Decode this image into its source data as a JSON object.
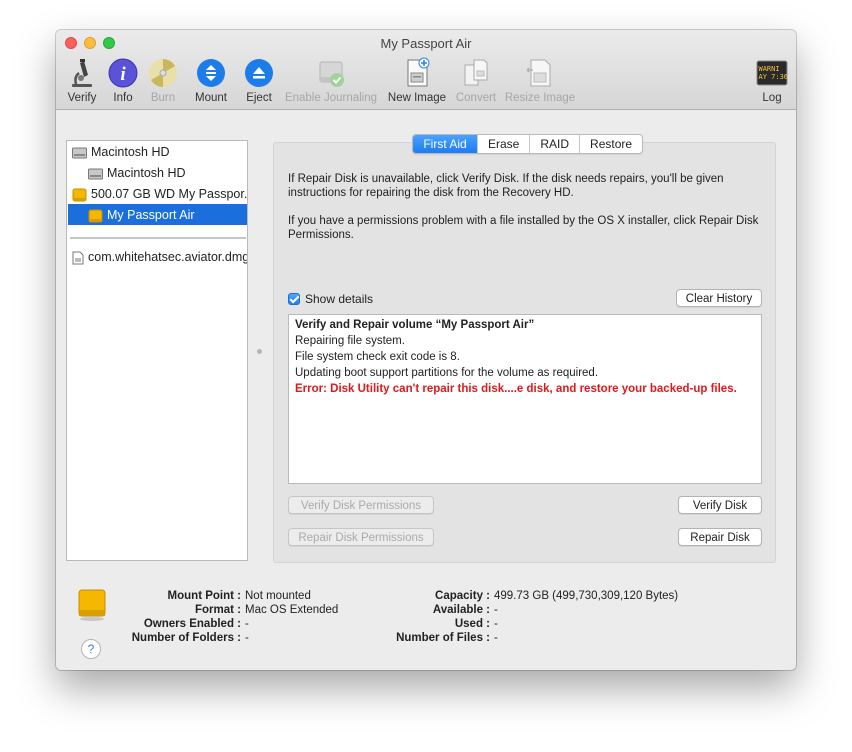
{
  "window": {
    "title": "My Passport Air"
  },
  "toolbar": {
    "verify": "Verify",
    "info": "Info",
    "burn": "Burn",
    "mount": "Mount",
    "eject": "Eject",
    "enable_journaling": "Enable Journaling",
    "new_image": "New Image",
    "convert": "Convert",
    "resize_image": "Resize Image",
    "log": "Log",
    "log_icon_text_1": "WARNI",
    "log_icon_text_2": "AY 7:36"
  },
  "sidebar": {
    "items": [
      {
        "label": "Macintosh HD"
      },
      {
        "label": "Macintosh HD"
      },
      {
        "label": "500.07 GB WD My Passpor..."
      },
      {
        "label": "My Passport Air"
      },
      {
        "label": "com.whitehatsec.aviator.dmg"
      }
    ]
  },
  "tabs": [
    "First Aid",
    "Erase",
    "RAID",
    "Restore"
  ],
  "first_aid": {
    "info1": "If Repair Disk is unavailable, click Verify Disk. If the disk needs repairs, you'll be given instructions for repairing the disk from the Recovery HD.",
    "info2": "If you have a permissions problem with a file installed by the OS X installer, click Repair Disk Permissions.",
    "show_details": "Show details",
    "show_details_checked": true,
    "clear_history": "Clear History",
    "log": [
      "Verify and Repair volume “My Passport Air”",
      "Repairing file system.",
      "File system check exit code is 8.",
      "Updating boot support partitions for the volume as required.",
      "Error: Disk Utility can't repair this disk....e disk, and restore your backed-up files."
    ],
    "verify_permissions": "Verify Disk Permissions",
    "repair_permissions": "Repair Disk Permissions",
    "verify_disk": "Verify Disk",
    "repair_disk": "Repair Disk"
  },
  "footer": {
    "mount_point_label": "Mount Point :",
    "mount_point": "Not mounted",
    "format_label": "Format :",
    "format": "Mac OS Extended",
    "owners_label": "Owners Enabled :",
    "owners": "-",
    "folders_label": "Number of Folders :",
    "folders": "-",
    "capacity_label": "Capacity :",
    "capacity": "499.73 GB (499,730,309,120 Bytes)",
    "available_label": "Available :",
    "available": "-",
    "used_label": "Used :",
    "used": "-",
    "files_label": "Number of Files :",
    "files": "-",
    "help": "?"
  },
  "colors": {
    "accent": "#1a6fdd",
    "error": "#e0191b",
    "drive": "#f5b700"
  }
}
